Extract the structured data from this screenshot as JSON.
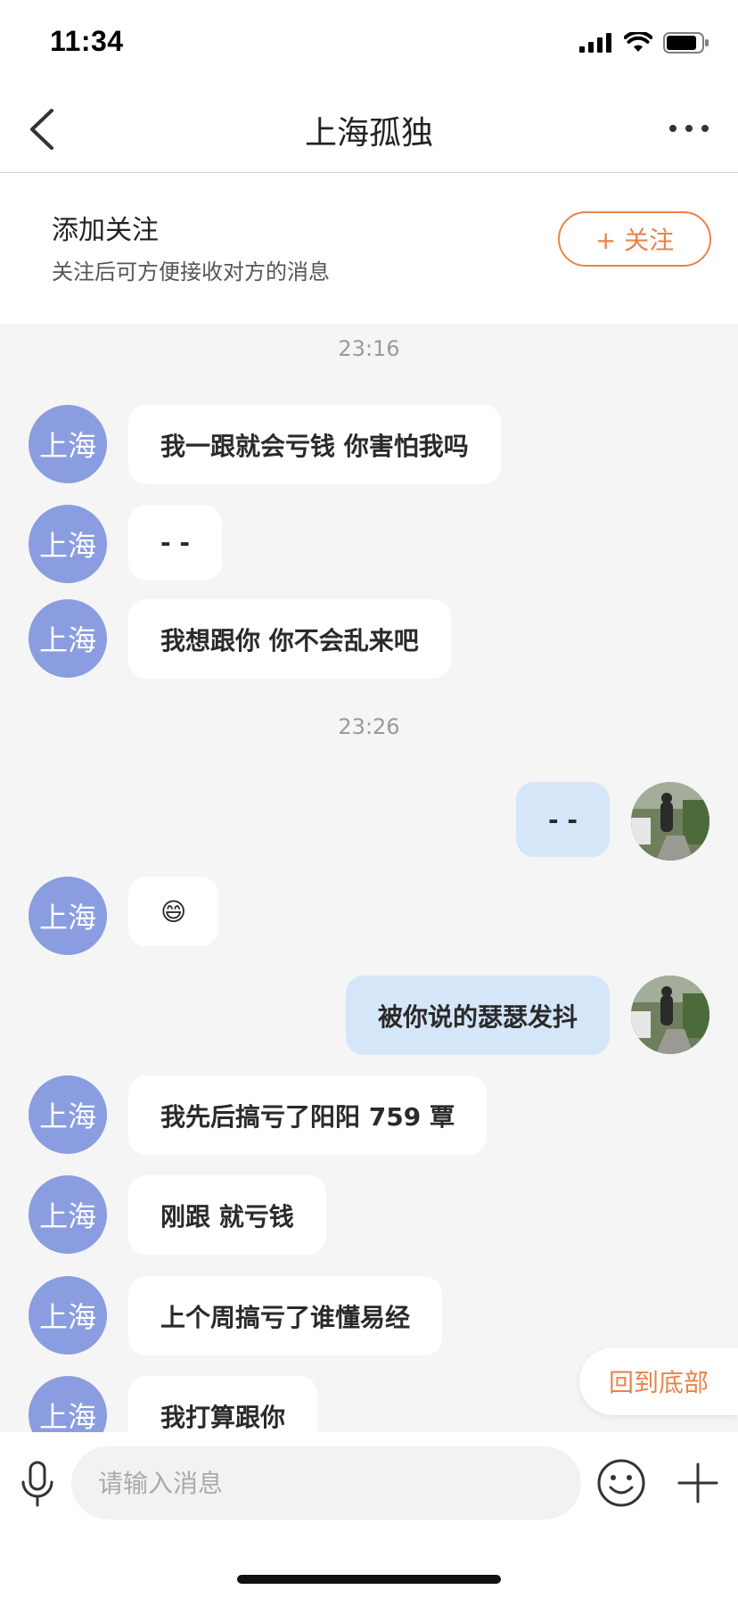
{
  "status_bar": {
    "time": "11:34"
  },
  "nav": {
    "title": "上海孤独"
  },
  "follow": {
    "title": "添加关注",
    "subtitle": "关注后可方便接收对方的消息",
    "button_label": "+ 关注"
  },
  "chat": {
    "timestamps": [
      "23:16",
      "23:26"
    ],
    "other_avatar_text": "上海",
    "messages": [
      {
        "sender": "other",
        "text": "我一跟就会亏钱 你害怕我吗"
      },
      {
        "sender": "other",
        "text": "- -"
      },
      {
        "sender": "other",
        "text": "我想跟你 你不会乱来吧"
      },
      {
        "sender": "me",
        "text": "- -"
      },
      {
        "sender": "other",
        "text": "😄"
      },
      {
        "sender": "me",
        "text": "被你说的瑟瑟发抖"
      },
      {
        "sender": "other",
        "text": "我先后搞亏了阳阳 759 覃"
      },
      {
        "sender": "other",
        "text": "刚跟 就亏钱"
      },
      {
        "sender": "other",
        "text": "上个周搞亏了谁懂易经"
      },
      {
        "sender": "other",
        "text": "我打算跟你"
      }
    ],
    "back_to_bottom_label": "回到底部"
  },
  "input": {
    "placeholder": "请输入消息",
    "value": ""
  },
  "icons": {
    "back": "chevron-left-icon",
    "more": "more-dots-icon",
    "mic": "microphone-icon",
    "emoji": "emoji-icon",
    "plus": "plus-icon"
  },
  "colors": {
    "accent": "#e8844a",
    "avatar_bg": "#8a9de0",
    "my_bubble": "#d5e6f9",
    "chat_bg": "#f5f5f5"
  }
}
